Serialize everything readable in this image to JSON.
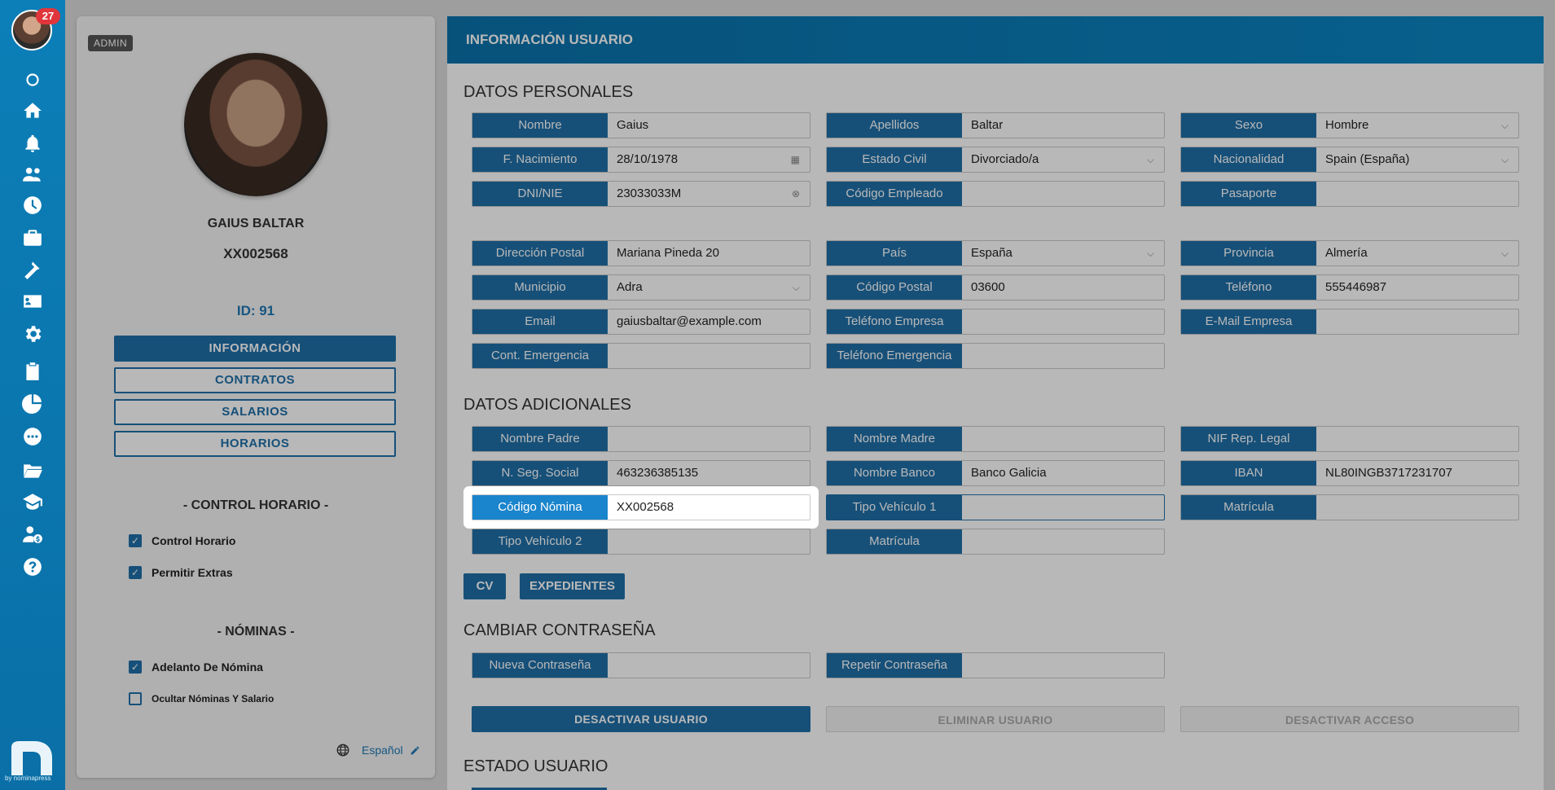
{
  "rail": {
    "notification_count": "27",
    "brand": "by nominapress",
    "icons": [
      "status-dot-icon",
      "home-icon",
      "bell-icon",
      "users-icon",
      "clock-icon",
      "briefcase-icon",
      "flag-icon",
      "id-card-icon",
      "gear-icon",
      "clipboard-icon",
      "pie-chart-icon",
      "chat-icon",
      "folder-icon",
      "graduation-cap-icon",
      "user-money-icon",
      "help-icon"
    ]
  },
  "profile": {
    "badge": "ADMIN",
    "name": "GAIUS BALTAR",
    "code": "XX002568",
    "id_label": "ID: 91",
    "nav": [
      "INFORMACIÓN",
      "CONTRATOS",
      "SALARIOS",
      "HORARIOS"
    ],
    "control_title": "- CONTROL HORARIO -",
    "control_options": [
      {
        "label": "Control Horario",
        "checked": true
      },
      {
        "label": "Permitir Extras",
        "checked": true
      }
    ],
    "nominas_title": "- NÓMINAS -",
    "nominas_options": [
      {
        "label": "Adelanto De Nómina",
        "checked": true
      },
      {
        "label": "Ocultar Nóminas Y Salario",
        "checked": false
      }
    ],
    "language": "Español"
  },
  "info": {
    "header": "INFORMACIÓN USUARIO",
    "personal_title": "DATOS PERSONALES",
    "personal": [
      {
        "label": "Nombre",
        "value": "Gaius"
      },
      {
        "label": "Apellidos",
        "value": "Baltar"
      },
      {
        "label": "Sexo",
        "value": "Hombre",
        "icon": "chevron-down-icon"
      },
      {
        "label": "F. Nacimiento",
        "value": "28/10/1978",
        "icon": "calendar-icon"
      },
      {
        "label": "Estado Civil",
        "value": "Divorciado/a",
        "icon": "chevron-down-icon"
      },
      {
        "label": "Nacionalidad",
        "value": "Spain (España)",
        "icon": "chevron-down-icon"
      },
      {
        "label": "DNI/NIE",
        "value": "23033033M",
        "icon": "clear-icon"
      },
      {
        "label": "Código Empleado",
        "value": ""
      },
      {
        "label": "Pasaporte",
        "value": ""
      },
      {
        "label": "Dirección Postal",
        "value": "Mariana Pineda 20"
      },
      {
        "label": "País",
        "value": "España",
        "icon": "chevron-down-icon"
      },
      {
        "label": "Provincia",
        "value": "Almería",
        "icon": "chevron-down-icon"
      },
      {
        "label": "Municipio",
        "value": "Adra",
        "icon": "chevron-down-icon"
      },
      {
        "label": "Código Postal",
        "value": "03600"
      },
      {
        "label": "Teléfono",
        "value": "555446987"
      },
      {
        "label": "Email",
        "value": "gaiusbaltar@example.com"
      },
      {
        "label": "Teléfono Empresa",
        "value": ""
      },
      {
        "label": "E-Mail Empresa",
        "value": ""
      },
      {
        "label": "Cont. Emergencia",
        "value": ""
      },
      {
        "label": "Teléfono Emergencia",
        "value": ""
      }
    ],
    "additional_title": "DATOS ADICIONALES",
    "additional": [
      {
        "label": "Nombre Padre",
        "value": ""
      },
      {
        "label": "Nombre Madre",
        "value": ""
      },
      {
        "label": "NIF Rep. Legal",
        "value": ""
      },
      {
        "label": "N. Seg. Social",
        "value": "463236385135"
      },
      {
        "label": "Nombre Banco",
        "value": "Banco Galicia"
      },
      {
        "label": "IBAN",
        "value": "NL80INGB3717231707"
      },
      {
        "label": "Código Nómina",
        "value": "XX002568"
      },
      {
        "label": "Tipo Vehículo 1",
        "value": ""
      },
      {
        "label": "Matrícula",
        "value": ""
      },
      {
        "label": "Tipo Vehículo 2",
        "value": ""
      },
      {
        "label": "Matrícula",
        "value": ""
      }
    ],
    "buttons": {
      "cv": "CV",
      "expedientes": "EXPEDIENTES"
    },
    "password_title": "CAMBIAR CONTRASEÑA",
    "password": [
      {
        "label": "Nueva Contraseña",
        "value": ""
      },
      {
        "label": "Repetir Contraseña",
        "value": ""
      }
    ],
    "actions": [
      "DESACTIVAR USUARIO",
      "ELIMINAR USUARIO",
      "DESACTIVAR ACCESO"
    ],
    "status_title": "ESTADO USUARIO"
  },
  "colors": {
    "primary": "#1f6fa8",
    "header": "#0b80bd",
    "badge": "#e0363b"
  }
}
